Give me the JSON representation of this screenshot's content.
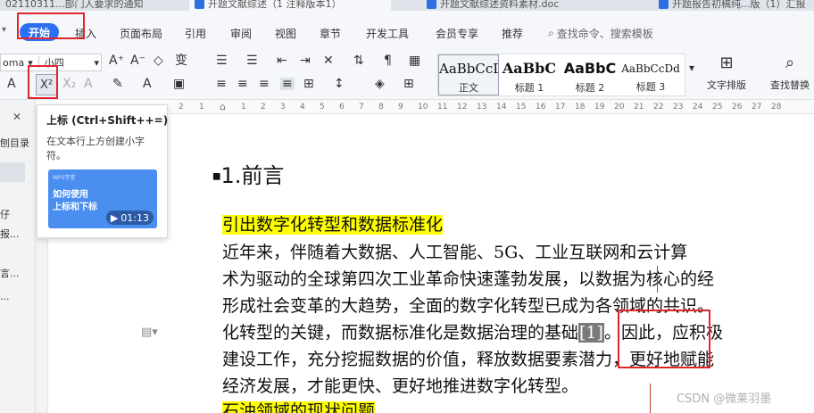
{
  "tabs": [
    {
      "label": "02110311...部门人要求的通知",
      "active": false
    },
    {
      "label": "开题文献综述（1 注释版本1）",
      "active": true
    },
    {
      "label": "开题文献综述资料素材.doc",
      "active": false
    },
    {
      "label": "开题报告初稿纯...版（1）汇报",
      "active": false
    }
  ],
  "menu": {
    "start": "开始",
    "items": [
      "插入",
      "页面布局",
      "引用",
      "审阅",
      "视图",
      "章节",
      "开发工具",
      "会员专享",
      "推荐"
    ],
    "search": "查找命令、搜索模板"
  },
  "ribbon": {
    "font_name": "oma",
    "font_size": "小四",
    "superscript_glyph": "X²",
    "styles": [
      {
        "preview": "AaBbCcDd",
        "name": "正文"
      },
      {
        "preview": "AaBbC",
        "name": "标题 1"
      },
      {
        "preview": "AaBbC",
        "name": "标题 2"
      },
      {
        "preview": "AaBbCcDd",
        "name": "标题 3"
      }
    ],
    "text_layout": "文字排版",
    "find_replace": "查找替换"
  },
  "ruler_ticks": [
    "2",
    "1",
    "",
    "1",
    "2",
    "3",
    "4",
    "5",
    "6",
    "7",
    "8",
    "9",
    "10",
    "11",
    "12",
    "13",
    "14",
    "15",
    "16",
    "17",
    "18",
    "19",
    "20",
    "21",
    "22",
    "23",
    "24",
    "25",
    "26",
    "27",
    "28"
  ],
  "nav": {
    "close": "✕",
    "items": [
      "刨目录",
      "仔",
      "报...",
      "言...",
      "..."
    ]
  },
  "tooltip": {
    "title": "上标 (Ctrl+Shift++=)",
    "desc": "在文本行上方创建小字符。",
    "brand": "WPS学堂",
    "video_title": "如何使用\n上标和下标",
    "duration": "01:13"
  },
  "doc": {
    "heading": "1.前言",
    "subheading": "引出数字化转型和数据标准化",
    "lines": [
      "    近年来，伴随着大数据、人工智能、5G、工业互联网和云计算",
      "术为驱动的全球第四次工业革命快速蓬勃发展，以数据为核心的经",
      "形成社会变革的大趋势，全面的数字化转型已成为各领域的共识。",
      "建设工作，充分挖掘数据的价值，释放数据要素潜力，更好地赋能",
      "经济发展，才能更快、更好地推进数字化转型。"
    ],
    "line4_pre": "化转型的关键，而数据标准化是数据治理的基础",
    "citation": "[1]",
    "line4_post": "。因此，应积极",
    "next_heading": "石油领域的现状问题"
  },
  "watermark": "CSDN @微莱羽墨",
  "colors": {
    "accent": "#2d6ff2",
    "annotation_red": "#e0262d",
    "highlight": "#ffff00"
  }
}
